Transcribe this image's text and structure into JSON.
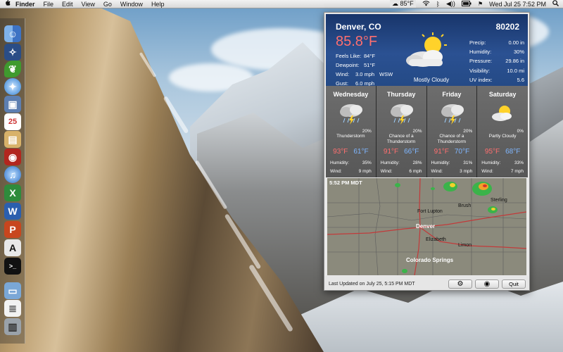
{
  "menubar": {
    "apple": "",
    "items": [
      "Finder",
      "File",
      "Edit",
      "View",
      "Go",
      "Window",
      "Help"
    ],
    "status": {
      "weather_temp": "85°F",
      "clock": "Wed Jul 25  7:52 PM"
    }
  },
  "current": {
    "location": "Denver, CO",
    "zip": "80202",
    "temp": "85.8°F",
    "condition": "Mostly Cloudy",
    "feels_like_label": "Feels Like:",
    "feels_like": "84°F",
    "dewpoint_label": "Dewpoint:",
    "dewpoint": "51°F",
    "wind_label": "Wind:",
    "wind_speed": "3.0 mph",
    "wind_dir": "WSW",
    "gust_label": "Gust:",
    "gust": "6.0 mph",
    "right": [
      {
        "label": "Precip:",
        "value": "0.00 in"
      },
      {
        "label": "Humidity:",
        "value": "30%"
      },
      {
        "label": "Pressure:",
        "value": "29.86 in"
      },
      {
        "label": "Visibility:",
        "value": "10.0 mi"
      },
      {
        "label": "UV index:",
        "value": "5.6"
      }
    ]
  },
  "forecast": [
    {
      "day": "Wednesday",
      "icon": "thunderstorm-icon",
      "pop": "20%",
      "desc": "Thunderstorm",
      "hi": "93°F",
      "lo": "61°F",
      "humidity_label": "Humidity:",
      "humidity": "35%",
      "wind_label": "Wind:",
      "wind": "9 mph"
    },
    {
      "day": "Thursday",
      "icon": "thunderstorm-icon",
      "pop": "20%",
      "desc": "Chance of a Thunderstorm",
      "hi": "91°F",
      "lo": "66°F",
      "humidity_label": "Humidity:",
      "humidity": "28%",
      "wind_label": "Wind:",
      "wind": "6 mph"
    },
    {
      "day": "Friday",
      "icon": "thunderstorm-icon",
      "pop": "20%",
      "desc": "Chance of a Thunderstorm",
      "hi": "91°F",
      "lo": "70°F",
      "humidity_label": "Humidity:",
      "humidity": "31%",
      "wind_label": "Wind:",
      "wind": "3 mph"
    },
    {
      "day": "Saturday",
      "icon": "partly-cloudy-icon",
      "pop": "0%",
      "desc": "Partly Cloudy",
      "hi": "95°F",
      "lo": "68°F",
      "humidity_label": "Humidity:",
      "humidity": "33%",
      "wind_label": "Wind:",
      "wind": "7 mph"
    }
  ],
  "map": {
    "time": "5:52 PM MDT",
    "cities": [
      "Denver",
      "Colorado Springs",
      "Fort Lupton",
      "Brush",
      "Elizabeth",
      "Limon",
      "Sterling"
    ]
  },
  "footer": {
    "updated": "Last Updated on July 25, 5:15 PM MDT",
    "settings_icon": "gear-icon",
    "view_icon": "eye-icon",
    "quit": "Quit"
  },
  "colors": {
    "hi_temp": "#ff6f6f",
    "lo_temp": "#7fb6ff",
    "header_bg": "#244a86"
  }
}
